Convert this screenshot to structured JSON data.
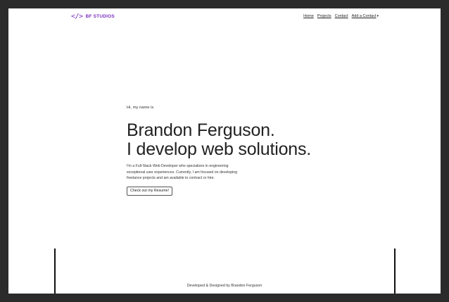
{
  "nav": {
    "brand_icon": "</>",
    "brand_text": "BF STUDIOS",
    "links": [
      "Home",
      "Projects",
      "Contact",
      "Add a Contact"
    ],
    "dropdown_caret": "▾"
  },
  "hero": {
    "greeting": "Hi, my name is",
    "title_line1": "Brandon Ferguson.",
    "title_line2": "I develop web solutions.",
    "description": "I'm a Full-Stack Web Developer who specializes in engineering exceptional user experiences. Currently, I am focused on developing freelance projects and am available to contract or hire.",
    "resume_button": "Check out my Resume!"
  },
  "footer": {
    "credit": "Developed & Designed by Brandon Ferguson"
  },
  "colors": {
    "brand": "#7b2fbf",
    "frame": "#2b2b2b",
    "background": "#ffffff"
  }
}
